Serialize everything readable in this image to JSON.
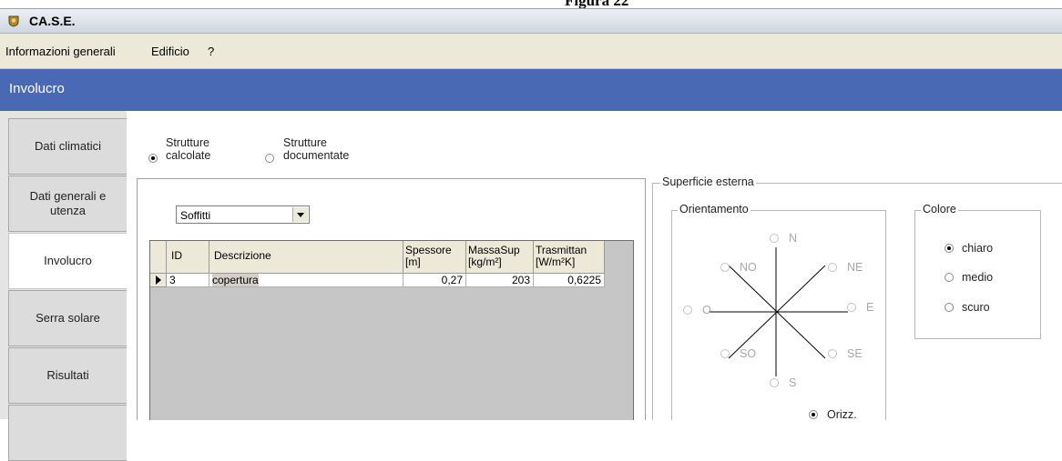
{
  "document": {
    "caption": "Figura 22"
  },
  "window": {
    "title": "CA.S.E."
  },
  "menu": [
    "Informazioni generali",
    "Edificio",
    "?"
  ],
  "section": {
    "title": "Involucro"
  },
  "nav": [
    {
      "label": "Dati climatici",
      "active": false
    },
    {
      "label": "Dati generali e\nutenza",
      "active": false
    },
    {
      "label": "Involucro",
      "active": true
    },
    {
      "label": "Serra solare",
      "active": false
    },
    {
      "label": "Risultati",
      "active": false
    }
  ],
  "structure_type": {
    "options": [
      {
        "label": "Strutture\ncalcolate",
        "selected": true
      },
      {
        "label": "Strutture\ndocumentate",
        "selected": false
      }
    ]
  },
  "dropdown": {
    "value": "Soffitti"
  },
  "table": {
    "columns": [
      "ID",
      "Descrizione",
      "Spessore\n[m]",
      "MassaSup\n[kg/m²]",
      "Trasmittan\n[W/m²K]"
    ],
    "rows": [
      {
        "id": "3",
        "descrizione": "copertura",
        "spessore": "0,27",
        "massa": "203",
        "trasmittanza": "0,6225"
      }
    ]
  },
  "superficie": {
    "legend": "Superficie esterna",
    "orientamento": {
      "legend": "Orientamento",
      "options": [
        "N",
        "NE",
        "E",
        "SE",
        "S",
        "SO",
        "O",
        "NO",
        "Orizz."
      ],
      "selected": "Orizz."
    },
    "colore": {
      "legend": "Colore",
      "options": [
        "chiaro",
        "medio",
        "scuro"
      ],
      "selected": "chiaro"
    }
  },
  "colors": {
    "header_bg": "#4a69b5",
    "menu_bg": "#ece9d8",
    "nav_bg": "#dcdcdc"
  }
}
